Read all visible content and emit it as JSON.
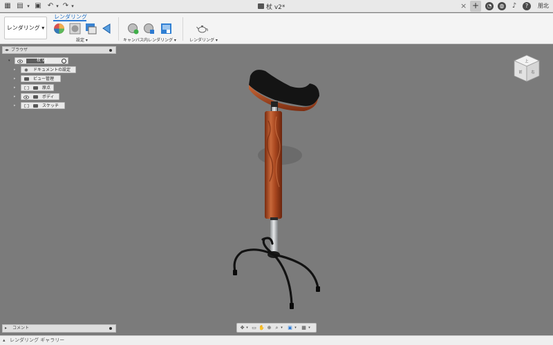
{
  "titlebar": {
    "doc_title": "杖 v2*",
    "user_initials": "朋北",
    "icons": [
      "grid-icon",
      "file-icon",
      "save-icon",
      "undo-icon",
      "redo-icon",
      "close-icon",
      "plus-icon",
      "clock-icon",
      "globe-icon",
      "bell-icon",
      "help-icon"
    ]
  },
  "toolbar": {
    "workspace_label": "レンダリング ▾",
    "ribbon_tab": "レンダリング",
    "groups": {
      "setup": "設定 ▾",
      "incanvas": "キャンバス内レンダリング ▾",
      "render": "レンダリング ▾"
    }
  },
  "browser": {
    "title": "ブラウザ",
    "root": "杖 v2",
    "items": [
      {
        "label": "ドキュメントの設定"
      },
      {
        "label": "ビュー管理"
      },
      {
        "label": "原点"
      },
      {
        "label": "ボディ"
      },
      {
        "label": "スケッチ"
      }
    ]
  },
  "comments": {
    "title": "コメント"
  },
  "status": {
    "gallery_label": "レンダリング ギャラリー"
  },
  "viewcube": {
    "face_labels": [
      "上",
      "前",
      "右"
    ]
  },
  "colors": {
    "viewport": "#7b7b7b",
    "accent": "#2a7ad6",
    "wood": "#b4522a",
    "metal_black": "#111111",
    "steel": "#b9bcbf"
  }
}
